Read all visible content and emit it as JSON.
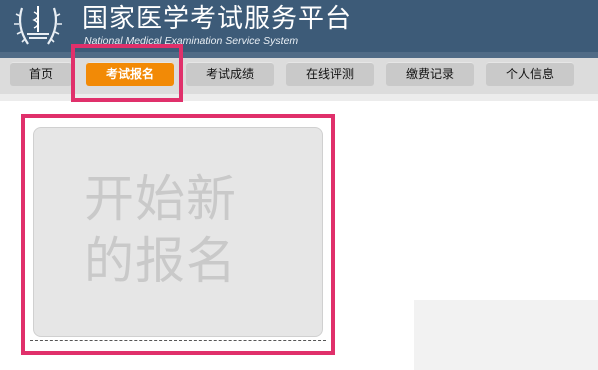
{
  "header": {
    "title": "国家医学考试服务平台",
    "subtitle": "National Medical Examination Service System",
    "bg_color": "#3d5b78"
  },
  "nav": {
    "items": [
      {
        "label": "首页",
        "active": false
      },
      {
        "label": "考试报名",
        "active": true
      },
      {
        "label": "考试成绩",
        "active": false
      },
      {
        "label": "在线评测",
        "active": false
      },
      {
        "label": "缴费记录",
        "active": false
      },
      {
        "label": "个人信息",
        "active": false
      }
    ],
    "active_color": "#f28a06",
    "highlight_color": "#e0306b"
  },
  "main": {
    "new_registration": {
      "line1": "开始新",
      "line2": "的报名"
    }
  }
}
